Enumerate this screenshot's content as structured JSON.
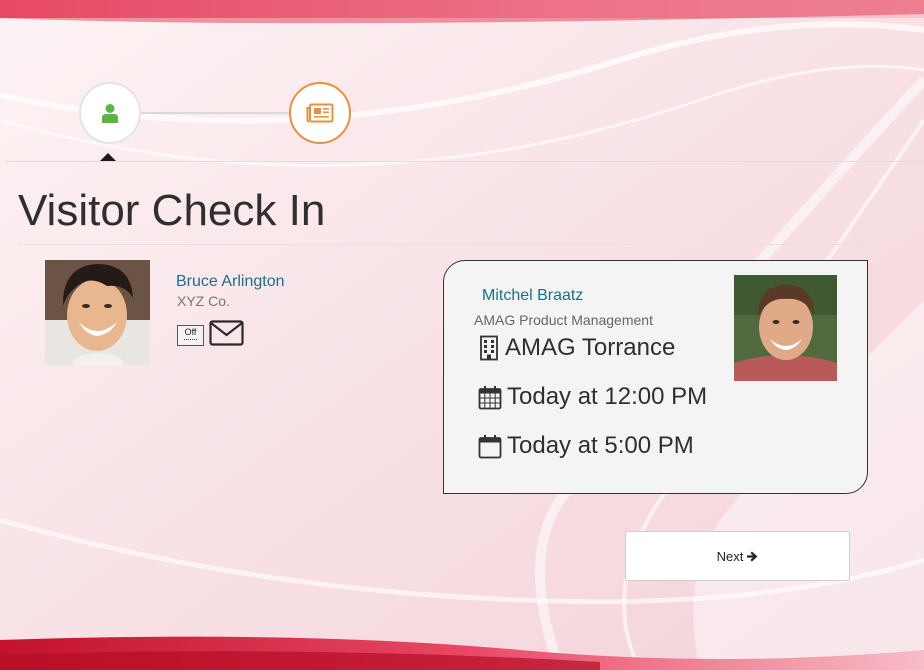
{
  "stepper": {
    "steps": [
      {
        "icon": "user-icon",
        "state": "active",
        "color": "#5ab543"
      },
      {
        "icon": "newspaper-icon",
        "state": "pending",
        "color": "#e8913a"
      }
    ]
  },
  "page": {
    "title": "Visitor Check In"
  },
  "visitor": {
    "name": "Bruce Arlington",
    "company": "XYZ Co.",
    "badge_label": "Off",
    "icons": [
      "off-badge-icon",
      "envelope-icon"
    ]
  },
  "host": {
    "name": "Mitchel Braatz",
    "department": "AMAG Product Management",
    "location": "AMAG Torrance",
    "start": "Today at 12:00 PM",
    "end": "Today at 5:00 PM",
    "icons": [
      "building-icon",
      "calendar-icon",
      "calendar-icon"
    ]
  },
  "actions": {
    "next_label": "Next",
    "next_icon": "arrow-right-icon"
  },
  "theme": {
    "accent_red": "#d41f3a",
    "link_blue": "#1d6f8e",
    "active_green": "#5ab543",
    "pending_orange": "#e8913a"
  }
}
